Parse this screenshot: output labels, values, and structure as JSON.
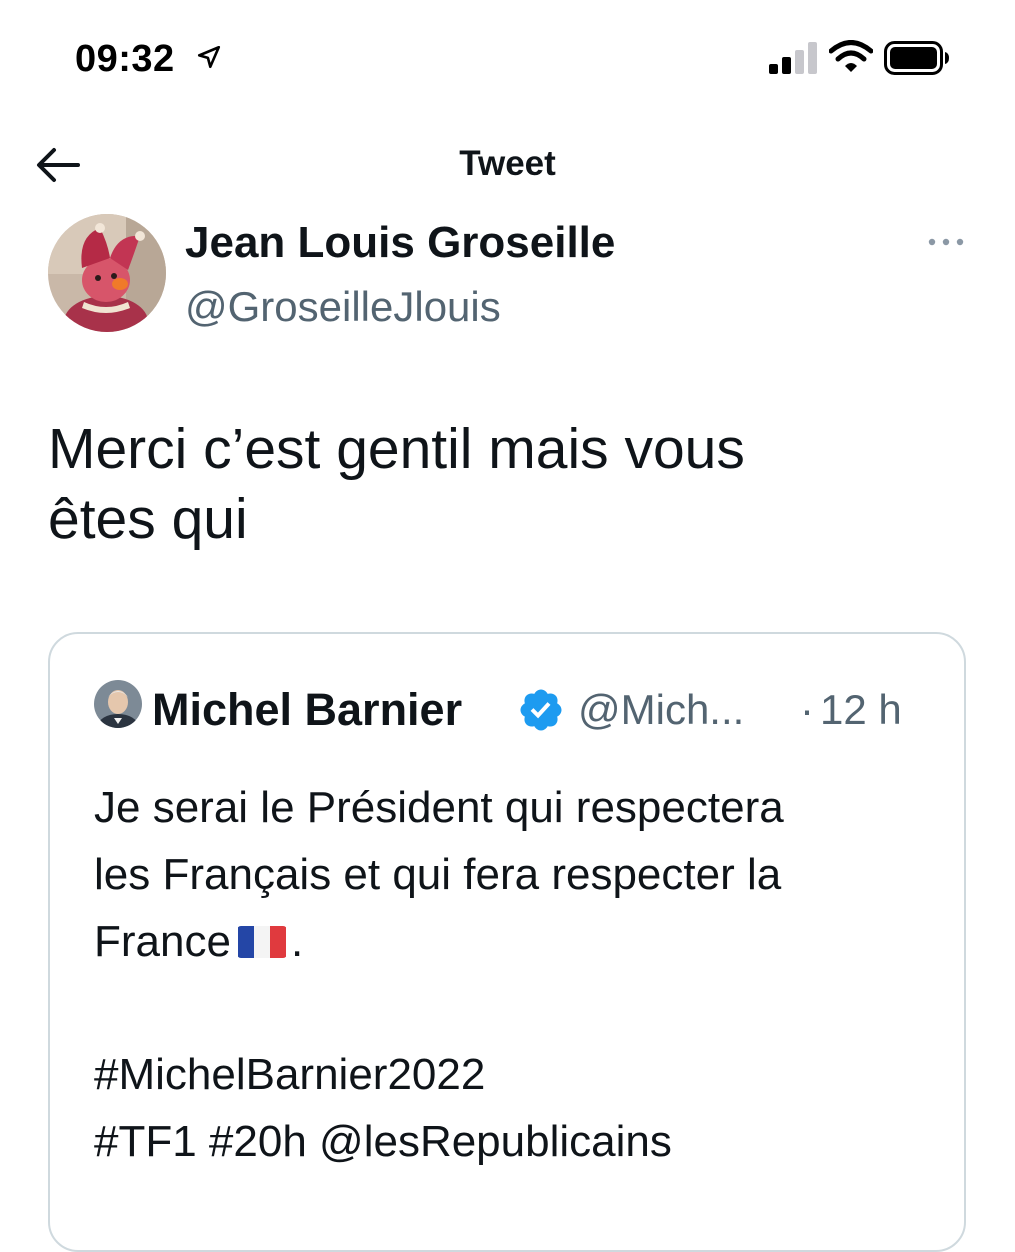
{
  "status_bar": {
    "time": "09:32",
    "icons": [
      "location-arrow-icon",
      "signal-icon",
      "wifi-icon",
      "battery-icon"
    ]
  },
  "header": {
    "title": "Tweet",
    "back_icon": "arrow-left-icon"
  },
  "tweet": {
    "author_name": "Jean Louis Groseille",
    "author_handle": "@GroseilleJlouis",
    "text": "Merci c’est gentil mais vous\nêtes qui",
    "more_icon": "ellipsis-icon"
  },
  "quoted_tweet": {
    "author_name": "Michel Barnier",
    "verified": true,
    "author_handle": "@Mich...",
    "separator": "·",
    "time": "12 h",
    "text_part1": "Je serai le Président qui respectera\nles Français et qui fera respecter la\nFrance",
    "text_part2": ".",
    "flag_icon": "france-flag-icon",
    "hashtags": "#MichelBarnier2022\n#TF1 #20h @lesRepublicains"
  },
  "colors": {
    "text_primary": "#0f1419",
    "text_secondary": "#536471",
    "verified_blue": "#1d9bf0",
    "border": "#cfd9de"
  }
}
